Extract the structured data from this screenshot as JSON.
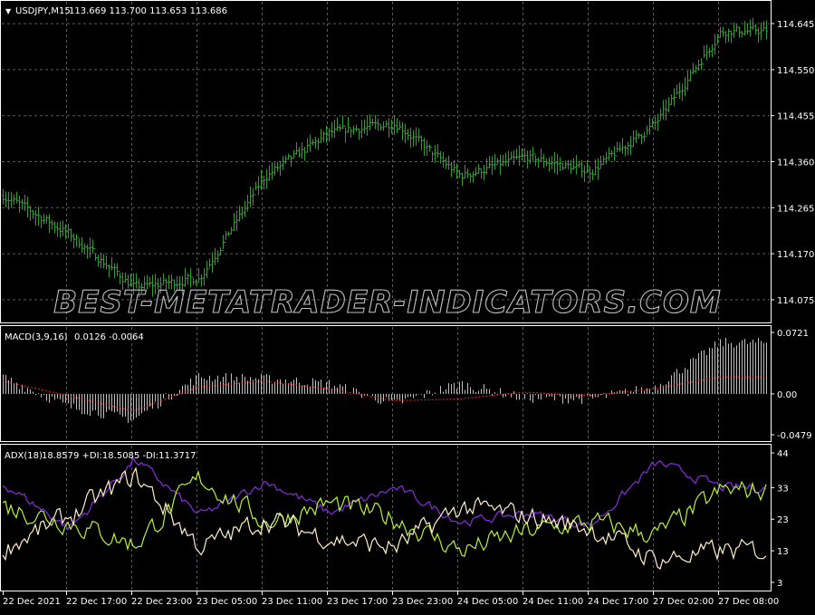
{
  "price_panel": {
    "symbol": "USDJPY,M15",
    "ohlc": "113.669 113.700 113.653 113.686",
    "y_ticks": [
      "114.645",
      "114.550",
      "114.455",
      "114.360",
      "114.265",
      "114.170",
      "114.075"
    ],
    "ylim": [
      114.03,
      114.69
    ],
    "watermark": "BEST-METATRADER-INDICATORS.COM",
    "colors": {
      "bars": "#2f9e2f",
      "grid": "#5a5a5a",
      "frame": "#ffffff"
    }
  },
  "macd_panel": {
    "title": "MACD(3,9,16)",
    "values": "0.0126 -0.0064",
    "y_ticks": [
      "0.0721",
      "0.00",
      "-0.0479"
    ],
    "ylim": [
      -0.0479,
      0.0721
    ],
    "colors": {
      "histogram": "#c0c0c0",
      "signal": "#ff2020"
    }
  },
  "adx_panel": {
    "title": "ADX(18)",
    "values": "18.8579 +DI:18.5085 -DI:11.3717",
    "y_ticks": [
      "44",
      "33",
      "23",
      "13",
      "3"
    ],
    "ylim": [
      3,
      44
    ],
    "colors": {
      "adx": "#8a2be2",
      "plus_di": "#b8f23a",
      "minus_di": "#ffefc8"
    }
  },
  "x_axis": {
    "labels": [
      "22 Dec 2021",
      "22 Dec 17:00",
      "22 Dec 23:00",
      "23 Dec 05:00",
      "23 Dec 11:00",
      "23 Dec 17:00",
      "23 Dec 23:00",
      "24 Dec 05:00",
      "24 Dec 11:00",
      "24 Dec 17:00",
      "27 Dec 02:00",
      "27 Dec 08:00"
    ]
  },
  "chart_data": [
    {
      "type": "bar",
      "series_kind": "ohlc-bars",
      "ylim": [
        114.03,
        114.69
      ],
      "x": [
        "22 Dec 2021",
        "22 Dec 17:00",
        "22 Dec 23:00",
        "23 Dec 05:00",
        "23 Dec 11:00",
        "23 Dec 17:00",
        "23 Dec 23:00",
        "24 Dec 05:00",
        "24 Dec 11:00",
        "24 Dec 17:00",
        "27 Dec 02:00",
        "27 Dec 08:00"
      ],
      "series": [
        {
          "values": [
            114.29,
            114.21,
            114.1,
            114.12,
            114.33,
            114.42,
            114.44,
            114.33,
            114.37,
            114.34,
            114.44,
            114.63
          ]
        }
      ]
    },
    {
      "type": "bar",
      "ylim": [
        -0.0479,
        0.0721
      ],
      "x": [
        "22 Dec 2021",
        "22 Dec 17:00",
        "22 Dec 23:00",
        "23 Dec 05:00",
        "23 Dec 11:00",
        "23 Dec 17:00",
        "23 Dec 23:00",
        "24 Dec 05:00",
        "24 Dec 11:00",
        "24 Dec 17:00",
        "27 Dec 02:00",
        "27 Dec 08:00"
      ],
      "series": [
        {
          "values": [
            0.02,
            -0.015,
            -0.03,
            0.02,
            0.018,
            0.012,
            -0.012,
            0.012,
            -0.005,
            -0.006,
            0.008,
            0.06
          ]
        },
        {
          "values": [
            0.015,
            -0.002,
            -0.02,
            0.008,
            0.015,
            0.006,
            -0.008,
            -0.006,
            0.002,
            -0.002,
            0.006,
            0.02
          ]
        }
      ]
    },
    {
      "type": "line",
      "ylim": [
        3,
        44
      ],
      "x": [
        "22 Dec 2021",
        "22 Dec 17:00",
        "22 Dec 23:00",
        "23 Dec 05:00",
        "23 Dec 11:00",
        "23 Dec 17:00",
        "23 Dec 23:00",
        "24 Dec 05:00",
        "24 Dec 11:00",
        "24 Dec 17:00",
        "27 Dec 02:00",
        "27 Dec 08:00"
      ],
      "series": [
        {
          "values": [
            34,
            20,
            42,
            24,
            35,
            25,
            33,
            22,
            25,
            21,
            41,
            33
          ]
        },
        {
          "values": [
            27,
            22,
            15,
            36,
            22,
            28,
            23,
            13,
            19,
            22,
            18,
            32
          ]
        },
        {
          "values": [
            14,
            24,
            37,
            14,
            23,
            17,
            14,
            27,
            24,
            20,
            10,
            13
          ]
        }
      ]
    }
  ]
}
